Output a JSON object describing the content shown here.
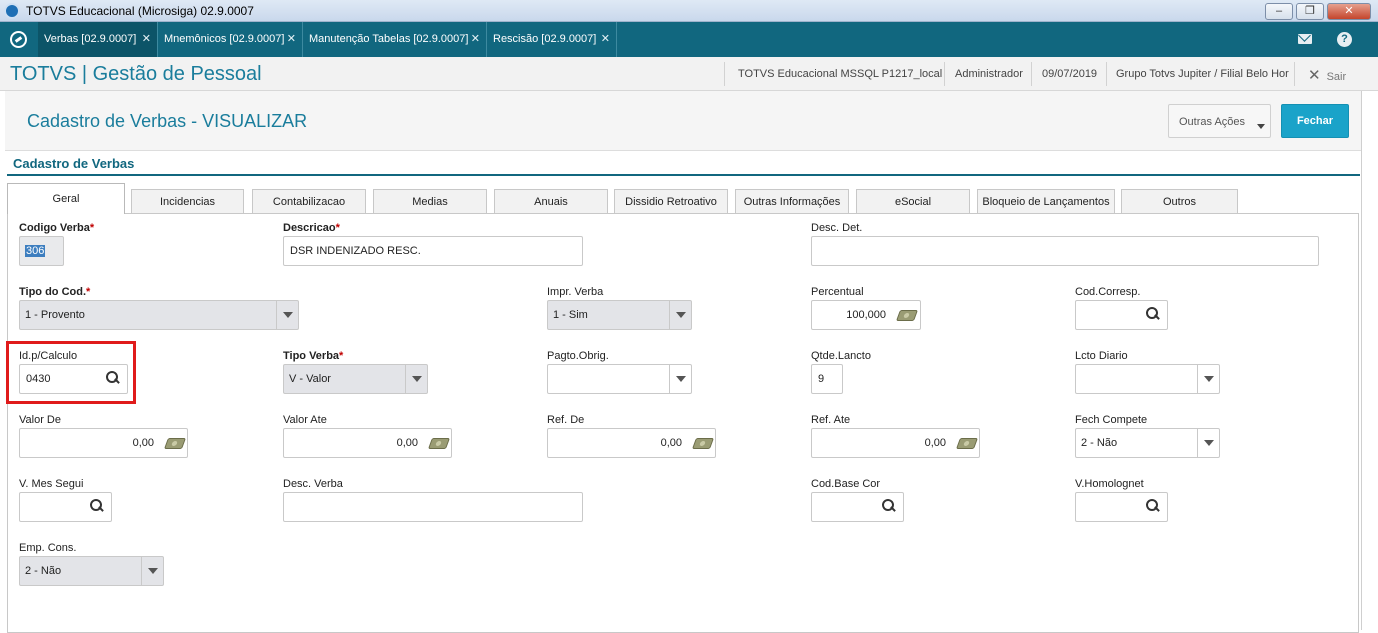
{
  "window": {
    "title": "TOTVS Educacional (Microsiga) 02.9.0007",
    "minimize": "–",
    "restore": "❐",
    "close": "✕"
  },
  "tabs": [
    {
      "label": "Verbas [02.9.0007]",
      "close": "✕",
      "active": true
    },
    {
      "label": "Mnemônicos [02.9.0007]",
      "close": "✕",
      "active": false
    },
    {
      "label": "Manutenção Tabelas [02.9.0007]",
      "close": "✕",
      "active": false
    },
    {
      "label": "Rescisão [02.9.0007]",
      "close": "✕",
      "active": false
    }
  ],
  "header": {
    "brand": "TOTVS | Gestão de Pessoal",
    "environment": "TOTVS Educacional MSSQL P1217_local",
    "user": "Administrador",
    "date": "09/07/2019",
    "branch": "Grupo Totvs Jupiter / Filial Belo Hor",
    "exit_label": "Sair",
    "help": "?"
  },
  "page": {
    "title": "Cadastro de Verbas - VISUALIZAR",
    "other_actions": "Outras Ações",
    "close_button": "Fechar",
    "section_title": "Cadastro de Verbas"
  },
  "form_tabs": [
    "Geral",
    "Incidencias",
    "Contabilizacao",
    "Medias",
    "Anuais",
    "Dissidio Retroativo",
    "Outras Informações",
    "eSocial",
    "Bloqueio de Lançamentos",
    "Outros"
  ],
  "fields": {
    "codigo_verba": {
      "label": "Codigo Verba",
      "value": "306"
    },
    "descricao": {
      "label": "Descricao",
      "value": "DSR INDENIZADO RESC."
    },
    "desc_det": {
      "label": "Desc. Det.",
      "value": ""
    },
    "tipo_cod": {
      "label": "Tipo do Cod.",
      "value": "1 - Provento"
    },
    "impr_verba": {
      "label": "Impr. Verba",
      "value": "1 - Sim"
    },
    "percentual": {
      "label": "Percentual",
      "value": "100,000"
    },
    "cod_corresp": {
      "label": "Cod.Corresp.",
      "value": ""
    },
    "id_calculo": {
      "label": "Id.p/Calculo",
      "value": "0430"
    },
    "tipo_verba": {
      "label": "Tipo Verba",
      "value": "V - Valor"
    },
    "pagto_obrig": {
      "label": "Pagto.Obrig.",
      "value": ""
    },
    "qtde_lancto": {
      "label": "Qtde.Lancto",
      "value": "9"
    },
    "lcto_diario": {
      "label": "Lcto Diario",
      "value": ""
    },
    "valor_de": {
      "label": "Valor De",
      "value": "0,00"
    },
    "valor_ate": {
      "label": "Valor Ate",
      "value": "0,00"
    },
    "ref_de": {
      "label": "Ref. De",
      "value": "0,00"
    },
    "ref_ate": {
      "label": "Ref. Ate",
      "value": "0,00"
    },
    "fech_compete": {
      "label": "Fech Compete",
      "value": "2 - Não"
    },
    "v_mes_segui": {
      "label": "V. Mes Segui",
      "value": ""
    },
    "desc_verba": {
      "label": "Desc. Verba",
      "value": ""
    },
    "cod_base_cor": {
      "label": "Cod.Base Cor",
      "value": ""
    },
    "v_homolognet": {
      "label": "V.Homolognet",
      "value": ""
    },
    "emp_cons": {
      "label": "Emp. Cons.",
      "value": "2 - Não"
    }
  },
  "required_mark": "*",
  "colors": {
    "teal": "#11677f",
    "accent": "#1aa3c9",
    "highlight": "#e01b1b"
  }
}
